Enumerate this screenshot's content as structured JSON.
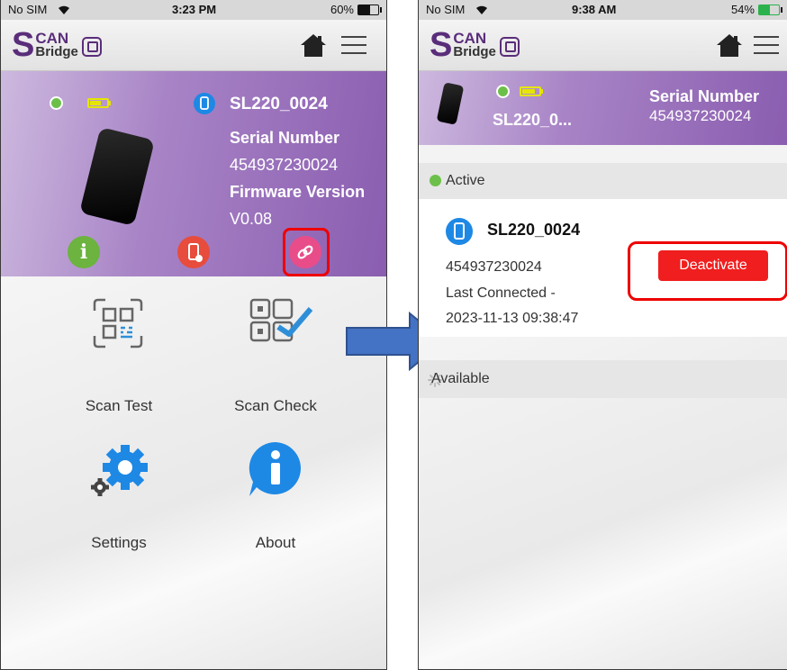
{
  "left_screen": {
    "status": {
      "carrier": "No SIM",
      "time": "3:23 PM",
      "battery": "60%"
    },
    "app_logo": "SCAN Bridge",
    "device": {
      "name": "SL220_0024",
      "serial_label": "Serial Number",
      "serial_value": "454937230024",
      "firmware_label": "Firmware Version",
      "firmware_value": "V0.08"
    },
    "actions": [
      "info-icon",
      "disconnect-device-icon",
      "link-icon"
    ],
    "menu": [
      {
        "label": "Scan Test",
        "icon": "scan-test-icon"
      },
      {
        "label": "Scan Check",
        "icon": "scan-check-icon"
      },
      {
        "label": "Settings",
        "icon": "settings-gear-icon"
      },
      {
        "label": "About",
        "icon": "about-info-icon"
      }
    ]
  },
  "right_screen": {
    "status": {
      "carrier": "No SIM",
      "time": "9:38 AM",
      "battery": "54%"
    },
    "app_logo": "SCAN Bridge",
    "device": {
      "name_short": "SL220_0...",
      "serial_label": "Serial Number",
      "serial_value": "454937230024"
    },
    "active_label": "Active",
    "active_device": {
      "name": "SL220_0024",
      "serial": "454937230024",
      "last_connected_label": "Last Connected -",
      "last_connected": "2023-11-13 09:38:47",
      "button_label": "Deactivate"
    },
    "available_label": "Available"
  },
  "colors": {
    "accent_purple": "#8a5db0",
    "highlight_red": "#e00000",
    "deactivate_red": "#f01e1e",
    "active_green": "#6cc04a",
    "icon_blue": "#1e88e5",
    "arrow_blue": "#4472c4"
  }
}
